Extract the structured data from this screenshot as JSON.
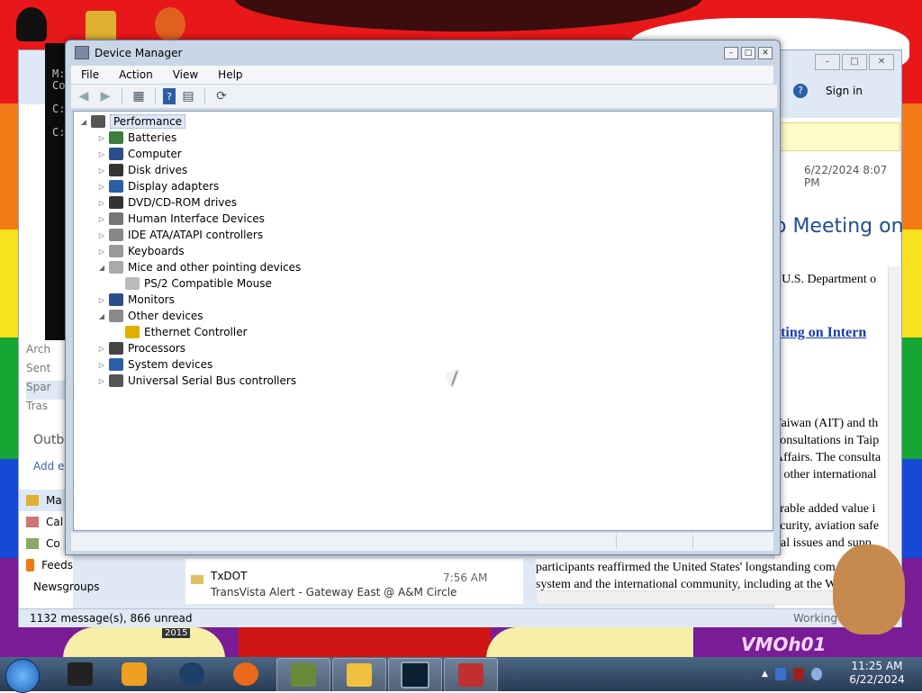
{
  "desktop": {
    "year_label": "2015",
    "watermark": "VMOh01"
  },
  "outlook": {
    "toolbar": {
      "help_icon": "help-icon",
      "sign_in": "Sign in"
    },
    "date": "6/22/2024 8:07 PM",
    "heading": "o Meeting on",
    "body_line": "r U.S. Department o",
    "link": "eting on Intern",
    "para1": [
      "Taiwan (AIT) and th",
      "consultations in Taip",
      "Affairs. The consulta",
      "d other international"
    ],
    "para2": [
      "erable added value i",
      "ecurity, aviation safe",
      "bal issues and supp"
    ],
    "bottom_text": [
      "participants reaffirmed the United States' longstanding com",
      "system and the international community, including at the W"
    ],
    "folders": [
      "Arch",
      "Sent",
      "Spar",
      "Tras"
    ],
    "outbox": "Outb",
    "add_favorite": "Add e",
    "nav": [
      {
        "label": "Ma",
        "icon": "mail-icon"
      },
      {
        "label": "Cal",
        "icon": "calendar-icon"
      },
      {
        "label": "Co",
        "icon": "contacts-icon"
      },
      {
        "label": "Feeds",
        "icon": "rss-icon"
      },
      {
        "label": "Newsgroups",
        "icon": "newsgroups-icon"
      }
    ],
    "message": {
      "from": "TxDOT",
      "subject": "TransVista Alert - Gateway East @ A&M Circle",
      "time": "7:56 AM"
    },
    "status_left": "1132 message(s), 866 unread",
    "status_right": "Working"
  },
  "cmd": {
    "lines": [
      "M:",
      "Co",
      "",
      "C:",
      "",
      "C:"
    ]
  },
  "device_manager": {
    "title": "Device Manager",
    "menu": [
      "File",
      "Action",
      "View",
      "Help"
    ],
    "toolbar": [
      "back-icon",
      "forward-icon",
      "show-hide-console-tree-icon",
      "help-icon",
      "properties-icon",
      "scan-hardware-icon"
    ],
    "root": "Performance",
    "tree": [
      {
        "label": "Batteries",
        "level": 1,
        "expander": "collapsed",
        "color": "#3b7d3b"
      },
      {
        "label": "Computer",
        "level": 1,
        "expander": "collapsed",
        "color": "#2a4e8c"
      },
      {
        "label": "Disk drives",
        "level": 1,
        "expander": "collapsed",
        "color": "#333333"
      },
      {
        "label": "Display adapters",
        "level": 1,
        "expander": "collapsed",
        "color": "#2a5fa6"
      },
      {
        "label": "DVD/CD-ROM drives",
        "level": 1,
        "expander": "collapsed",
        "color": "#333333"
      },
      {
        "label": "Human Interface Devices",
        "level": 1,
        "expander": "collapsed",
        "color": "#777777"
      },
      {
        "label": "IDE ATA/ATAPI controllers",
        "level": 1,
        "expander": "collapsed",
        "color": "#888888"
      },
      {
        "label": "Keyboards",
        "level": 1,
        "expander": "collapsed",
        "color": "#999999"
      },
      {
        "label": "Mice and other pointing devices",
        "level": 1,
        "expander": "expanded",
        "color": "#aaaaaa"
      },
      {
        "label": "PS/2 Compatible Mouse",
        "level": 2,
        "expander": "none",
        "color": "#bbbbbb"
      },
      {
        "label": "Monitors",
        "level": 1,
        "expander": "collapsed",
        "color": "#2a4e8c"
      },
      {
        "label": "Other devices",
        "level": 1,
        "expander": "expanded",
        "color": "#8a8a8a"
      },
      {
        "label": "Ethernet Controller",
        "level": 2,
        "expander": "none",
        "color": "#e0b000"
      },
      {
        "label": "Processors",
        "level": 1,
        "expander": "collapsed",
        "color": "#444444"
      },
      {
        "label": "System devices",
        "level": 1,
        "expander": "collapsed",
        "color": "#2a5fa6"
      },
      {
        "label": "Universal Serial Bus controllers",
        "level": 1,
        "expander": "collapsed",
        "color": "#555555"
      }
    ]
  },
  "taskbar": {
    "apps": [
      "explorer",
      "media-player",
      "network",
      "firefox",
      "box",
      "outlook-express",
      "cmd",
      "device-manager"
    ],
    "time": "11:25 AM",
    "date": "6/22/2024"
  }
}
